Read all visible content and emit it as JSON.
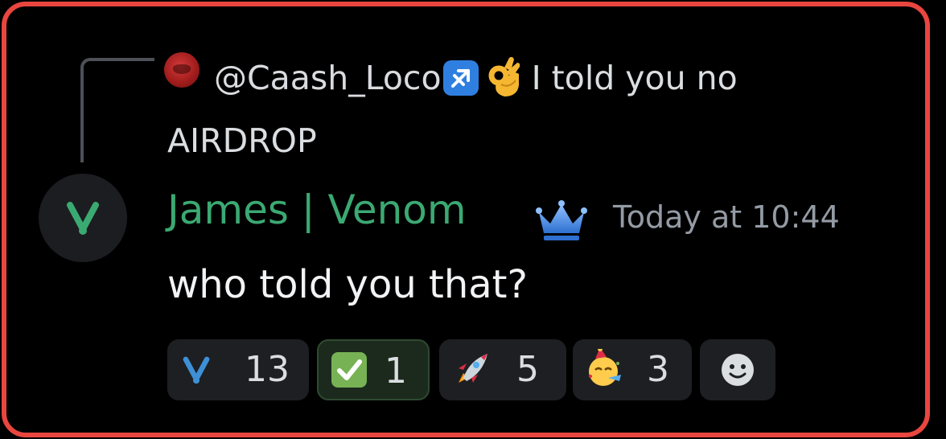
{
  "reply": {
    "mention": "@Caash_Loco",
    "text": "I told you no AIRDROP",
    "avatar_icon": "red-avatar-icon",
    "badge_icon": "sagittarius-icon",
    "emoji_icon": "ok-hand-icon"
  },
  "author": {
    "name": "James | Venom",
    "badge_icon": "crown-icon",
    "avatar_icon": "venom-logo-icon",
    "name_color": "#3ba972"
  },
  "timestamp": "Today at 10:44",
  "message": "who told you that?",
  "reactions": [
    {
      "icon": "venom-logo-icon",
      "count": "13",
      "active": false
    },
    {
      "icon": "check-mark-icon",
      "count": "1",
      "active": true
    },
    {
      "icon": "rocket-icon",
      "count": "5",
      "active": false
    },
    {
      "icon": "partying-face-icon",
      "count": "3",
      "active": false
    }
  ],
  "add_reaction_icon": "smiley-icon",
  "colors": {
    "frame_border": "#e8463f",
    "background": "#000000",
    "timestamp": "#949ba4"
  }
}
